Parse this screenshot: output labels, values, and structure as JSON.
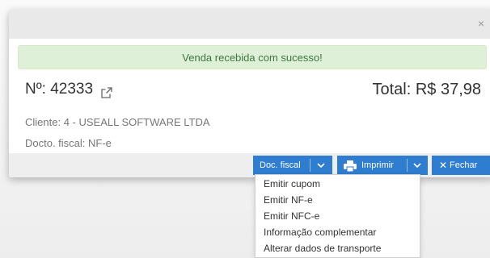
{
  "modal": {
    "close_glyph": "×",
    "alert_text": "Venda recebida com sucesso!",
    "order_number": "Nº: 42333",
    "total": "Total: R$ 37,98",
    "cliente": "Cliente: 4 - USEALL SOFTWARE LTDA",
    "docto_fiscal": "Docto. fiscal: NF-e"
  },
  "footer": {
    "doc_fiscal_label": "Doc. fiscal",
    "imprimir_label": "Imprimir",
    "fechar_label": "Fechar"
  },
  "dropdown": {
    "items": [
      {
        "label": "Emitir cupom"
      },
      {
        "label": "Emitir NF-e"
      },
      {
        "label": "Emitir NFC-e"
      },
      {
        "label": "Informação complementar"
      },
      {
        "label": "Alterar dados de transporte"
      }
    ]
  },
  "colors": {
    "primary": "#2f7dd1",
    "alert_bg": "#dff0d8",
    "alert_text": "#3c763d"
  },
  "icons": [
    "close-icon",
    "external-link-icon",
    "chevron-down-icon",
    "printer-icon",
    "times-icon"
  ]
}
